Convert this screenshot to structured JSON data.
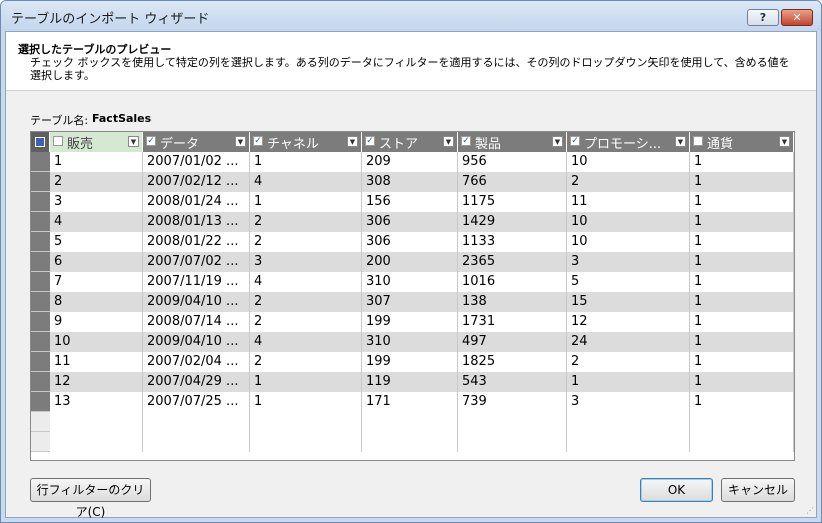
{
  "window": {
    "title": "テーブルのインポート ウィザード",
    "help_label": "?",
    "close_label": "✕"
  },
  "header": {
    "title": "選択したテーブルのプレビュー",
    "description": "チェック ボックスを使用して特定の列を選択します。ある列のデータにフィルターを適用するには、その列のドロップダウン矢印を使用して、含める値を選択します。"
  },
  "table_name": {
    "label": "テーブル名:",
    "value": "FactSales"
  },
  "grid": {
    "columns": [
      {
        "label": "販売",
        "checked": false
      },
      {
        "label": "データ",
        "checked": true
      },
      {
        "label": "チャネル",
        "checked": true
      },
      {
        "label": "ストア",
        "checked": true
      },
      {
        "label": "製品",
        "checked": true
      },
      {
        "label": "プロモーシ...",
        "checked": true
      },
      {
        "label": "通貨",
        "checked": false
      }
    ],
    "rows": [
      [
        "1",
        "2007/01/02 ...",
        "1",
        "209",
        "956",
        "10",
        "1"
      ],
      [
        "2",
        "2007/02/12 ...",
        "4",
        "308",
        "766",
        "2",
        "1"
      ],
      [
        "3",
        "2008/01/24 ...",
        "1",
        "156",
        "1175",
        "11",
        "1"
      ],
      [
        "4",
        "2008/01/13 ...",
        "2",
        "306",
        "1429",
        "10",
        "1"
      ],
      [
        "5",
        "2008/01/22 ...",
        "2",
        "306",
        "1133",
        "10",
        "1"
      ],
      [
        "6",
        "2007/07/02 ...",
        "3",
        "200",
        "2365",
        "3",
        "1"
      ],
      [
        "7",
        "2007/11/19 ...",
        "4",
        "310",
        "1016",
        "5",
        "1"
      ],
      [
        "8",
        "2009/04/10 ...",
        "2",
        "307",
        "138",
        "15",
        "1"
      ],
      [
        "9",
        "2008/07/14 ...",
        "2",
        "199",
        "1731",
        "12",
        "1"
      ],
      [
        "10",
        "2009/04/10 ...",
        "4",
        "310",
        "497",
        "24",
        "1"
      ],
      [
        "11",
        "2007/02/04 ...",
        "2",
        "199",
        "1825",
        "2",
        "1"
      ],
      [
        "12",
        "2007/04/29 ...",
        "1",
        "119",
        "543",
        "1",
        "1"
      ],
      [
        "13",
        "2007/07/25 ...",
        "1",
        "171",
        "739",
        "3",
        "1"
      ]
    ]
  },
  "buttons": {
    "clear_filter": "行フィルターのクリア(C)",
    "ok": "OK",
    "cancel": "キャンセル"
  }
}
